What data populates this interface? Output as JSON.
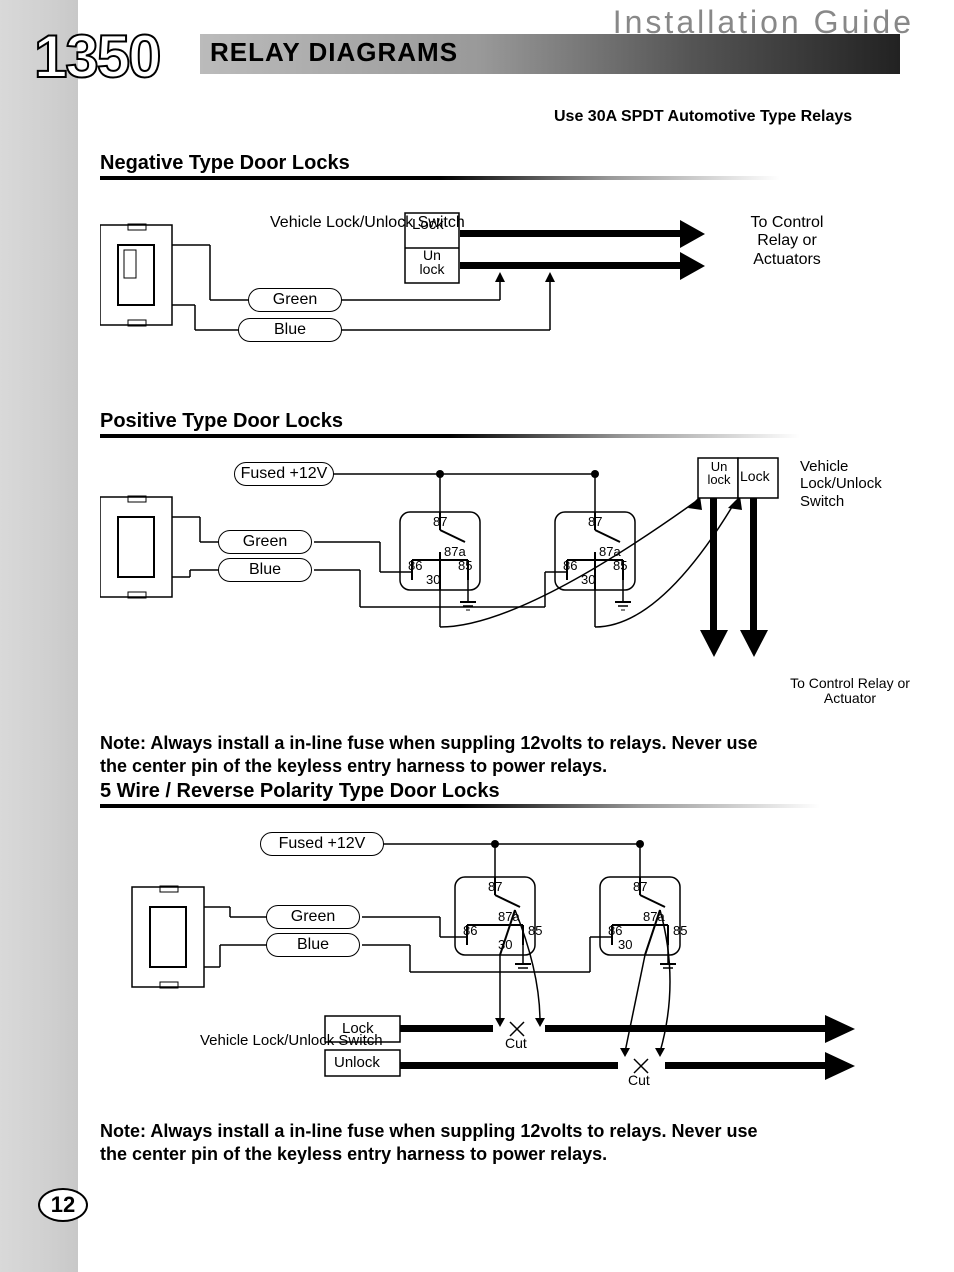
{
  "header": {
    "guide_title": "Installation Guide",
    "section_title": "RELAY DIAGRAMS",
    "model_number": "1350",
    "page_number": "12",
    "relay_spec": "Use 30A SPDT Automotive Type Relays"
  },
  "sections": {
    "negative": {
      "title": "Negative Type Door Locks",
      "labels": {
        "switch": "Vehicle Lock/Unlock Switch",
        "lock": "Lock",
        "unlock": "Un lock",
        "green": "Green",
        "blue": "Blue",
        "to_control": "To Control Relay or Actuators"
      }
    },
    "positive": {
      "title": "Positive Type Door Locks",
      "labels": {
        "fused": "Fused +12V",
        "green": "Green",
        "blue": "Blue",
        "unlock": "Un lock",
        "lock": "Lock",
        "switch": "Vehicle Lock/Unlock Switch",
        "pin87": "87",
        "pin87a": "87a",
        "pin86": "86",
        "pin85": "85",
        "pin30": "30",
        "to_control": "To Control Relay or Actuator"
      },
      "note": "Note: Always install a in-line fuse when suppling 12volts to relays. Never use the center pin of the keyless entry harness to power relays."
    },
    "fivewire": {
      "title": "5 Wire / Reverse Polarity Type Door Locks",
      "labels": {
        "fused": "Fused +12V",
        "green": "Green",
        "blue": "Blue",
        "lock": "Lock",
        "unlock": "Unlock",
        "switch": "Vehicle Lock/Unlock Switch",
        "cut": "Cut",
        "pin87": "87",
        "pin87a": "87a",
        "pin86": "86",
        "pin85": "85",
        "pin30": "30"
      },
      "note": "Note: Always install a in-line fuse when suppling 12volts to relays. Never use the center pin of the keyless entry harness to power relays."
    }
  }
}
